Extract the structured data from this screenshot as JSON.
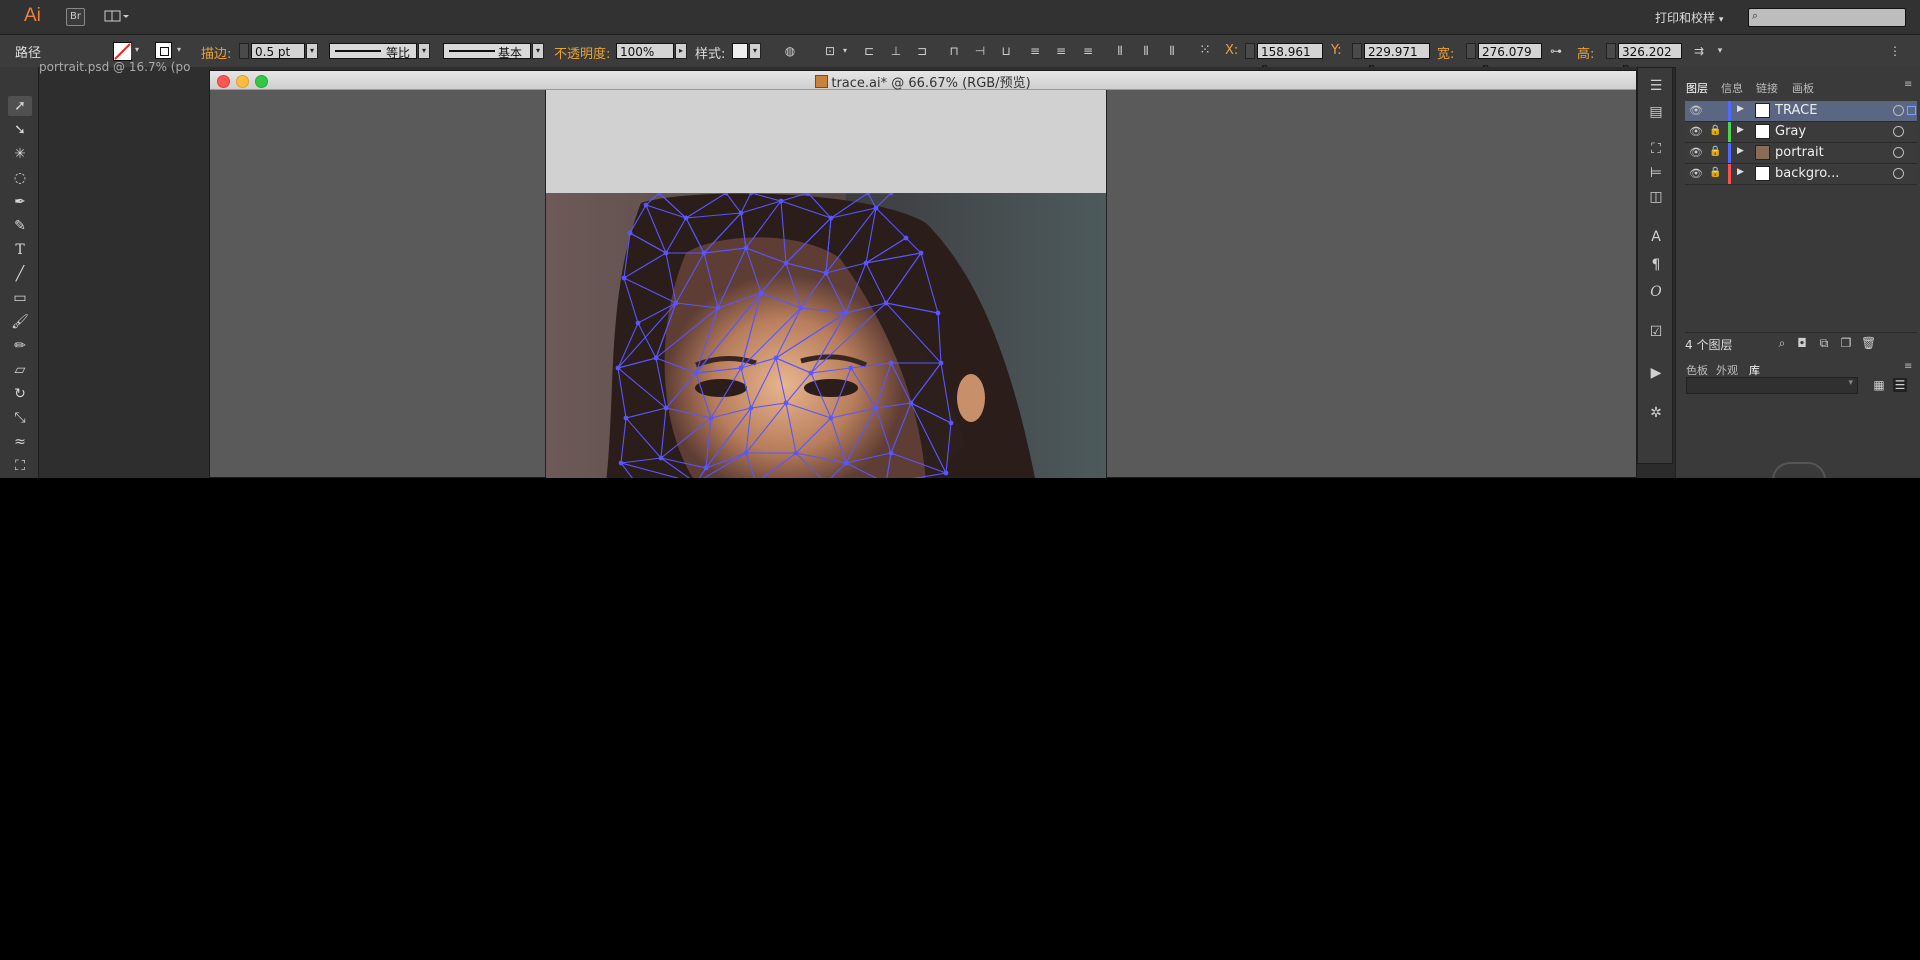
{
  "app": {
    "logo": "Ai",
    "bridge_button": "Br",
    "workspace_label": "打印和校样",
    "arrange_icon": "arrange-documents-icon"
  },
  "control_bar": {
    "selection_type": "路径",
    "stroke_label": "描边:",
    "stroke_value": "0.5 pt",
    "stroke_profile": "等比",
    "brush_def": "基本",
    "opacity_label": "不透明度:",
    "opacity_value": "100%",
    "style_label": "样式:",
    "x_label": "X:",
    "x_value": "158.961 n",
    "y_label": "Y:",
    "y_value": "229.971 n",
    "w_label": "宽:",
    "w_value": "276.079 n",
    "h_label": "高:",
    "h_value": "326.202 n"
  },
  "documents": {
    "background_tab": "portrait.psd @ 16.7% (po",
    "active_title": "trace.ai* @ 66.67% (RGB/预览)"
  },
  "panels": {
    "top_tabs": [
      "图层",
      "信息",
      "链接",
      "画板"
    ],
    "layers": [
      {
        "name": "TRACE",
        "color": "#4f6bff",
        "locked": false,
        "selected": true
      },
      {
        "name": "Gray",
        "color": "#4fd24f",
        "locked": true,
        "selected": false
      },
      {
        "name": "portrait",
        "color": "#4f6bff",
        "locked": true,
        "selected": false
      },
      {
        "name": "backgro...",
        "color": "#ff4f4f",
        "locked": true,
        "selected": false
      }
    ],
    "layer_count": "4 个图层",
    "bottom_tabs": [
      "色板",
      "外观",
      "库"
    ]
  },
  "colors": {
    "accent_orange": "#e8a23a",
    "mesh_blue": "#5b55ff",
    "selected_layer": "#5b6683"
  }
}
